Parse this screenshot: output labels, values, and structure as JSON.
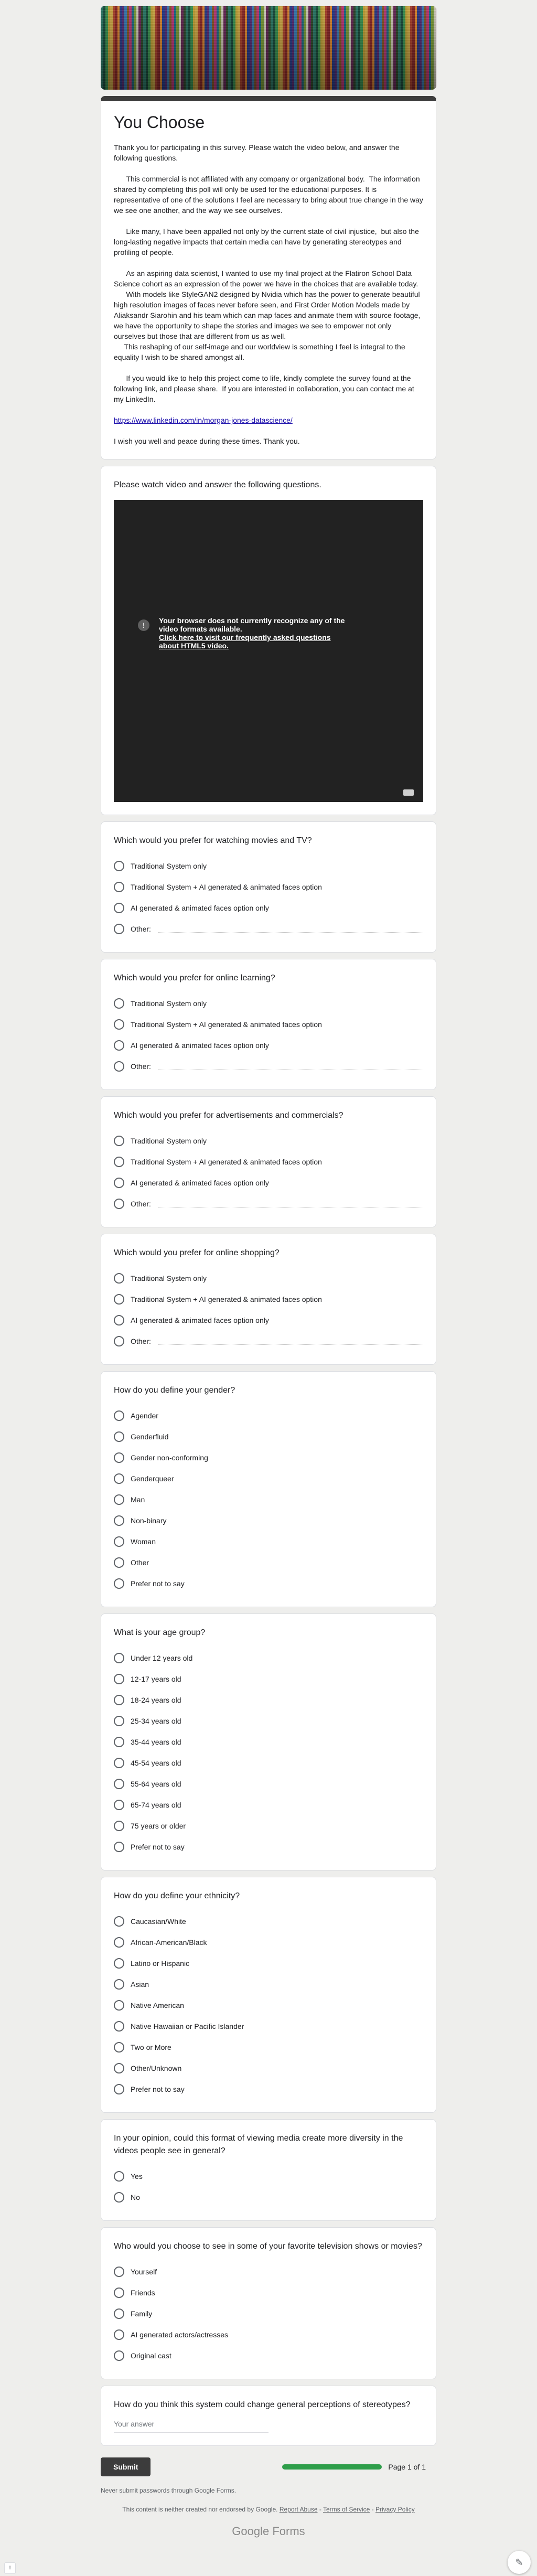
{
  "form": {
    "title": "You Choose",
    "description": [
      "Thank you for participating in this survey. Please watch the video below, and answer the following questions.",
      "",
      "      This commercial is not affiliated with any company or organizational body.  The information shared by completing this poll will only be used for the educational purposes. It is representative of one of the solutions I feel are necessary to bring about true change in the way we see one another, and the way we see ourselves.",
      "",
      "      Like many, I have been appalled not only by the current state of civil injustice,  but also the long-lasting negative impacts that certain media can have by generating stereotypes and profiling of people.",
      "",
      "      As an aspiring data scientist, I wanted to use my final project at the Flatiron School Data Science cohort as an expression of the power we have in the choices that are available today.",
      "      With models like StyleGAN2 designed by Nvidia which has the power to generate beautiful high resolution images of faces never before seen, and First Order Motion Models made by Aliaksandr Siarohin and his team which can map faces and animate them with source footage, we have the opportunity to shape the stories and images we see to empower not only ourselves but those that are different from us as well.",
      "     This reshaping of our self-image and our worldview is something I feel is integral to the equality I wish to be shared amongst all.",
      "",
      "      If you would like to help this project come to life, kindly complete the survey found at the following link, and please share.  If you are interested in collaboration, you can contact me at my LinkedIn.",
      "",
      "@@LINK@@",
      "",
      "I wish you well and peace during these times. Thank you."
    ],
    "link": "https://www.linkedin.com/in/morgan-jones-datascience/"
  },
  "video_section": {
    "title": "Please watch video and answer the following questions.",
    "message": "Your browser does not currently recognize any of the video formats available.",
    "link_text": "Click here to visit our frequently asked questions about HTML5 video."
  },
  "questions": [
    {
      "title": "Which would you prefer for watching movies and TV?",
      "options": [
        "Traditional System only",
        "Traditional System + AI generated & animated faces option",
        "AI generated & animated faces option only",
        "Other:"
      ]
    },
    {
      "title": "Which would you prefer for online learning?",
      "options": [
        "Traditional System only",
        "Traditional System + AI generated & animated faces option",
        "AI generated & animated faces option only",
        "Other:"
      ]
    },
    {
      "title": "Which would you prefer for advertisements and commercials?",
      "options": [
        "Traditional System only",
        "Traditional System + AI generated & animated faces option",
        "AI generated & animated faces option only",
        "Other:"
      ]
    },
    {
      "title": "Which would you prefer for online shopping?",
      "options": [
        "Traditional System only",
        "Traditional System + AI generated & animated faces option",
        "AI generated & animated faces option only",
        "Other:"
      ]
    },
    {
      "title": "How do you define your gender?",
      "options": [
        "Agender",
        "Genderfluid",
        "Gender non-conforming",
        "Genderqueer",
        "Man",
        "Non-binary",
        "Woman",
        "Other",
        "Prefer not to say"
      ]
    },
    {
      "title": "What is your age group?",
      "options": [
        "Under 12 years old",
        "12-17 years old",
        "18-24 years old",
        "25-34 years old",
        "35-44 years old",
        "45-54 years old",
        "55-64 years old",
        "65-74 years old",
        "75 years or older",
        "Prefer not to say"
      ]
    },
    {
      "title": "How do you define your ethnicity?",
      "options": [
        "Caucasian/White",
        "African-American/Black",
        "Latino or Hispanic",
        "Asian",
        "Native American",
        "Native Hawaiian or Pacific Islander",
        "Two or More",
        "Other/Unknown",
        "Prefer not to say"
      ]
    },
    {
      "title": "In your opinion, could this format of viewing media create more diversity in the videos people see in general?",
      "options": [
        "Yes",
        "No"
      ]
    },
    {
      "title": "Who would you choose to see in some of your favorite television shows or movies?",
      "options": [
        "Yourself",
        "Friends",
        "Family",
        "AI generated actors/actresses",
        "Original cast"
      ]
    }
  ],
  "text_question": {
    "title": "How do you think this system could change general perceptions of stereotypes?",
    "placeholder": "Your answer"
  },
  "footer": {
    "submit": "Submit",
    "page": "Page 1 of 1",
    "progress_percent": 100,
    "never_submit": "Never submit passwords through Google Forms.",
    "legal_prefix": "This content is neither created nor endorsed by Google. ",
    "report_abuse": "Report Abuse",
    "terms": "Terms of Service",
    "privacy": "Privacy Policy",
    "brand": "Google Forms"
  },
  "colors": {
    "accent": "#3c3c3c",
    "progress": "#2e9e4a"
  }
}
